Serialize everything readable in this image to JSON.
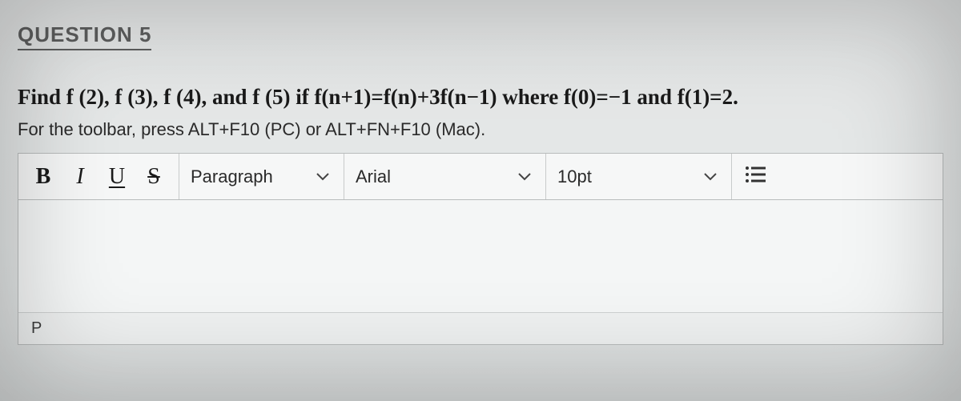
{
  "question": {
    "label": "QUESTION 5",
    "prompt": "Find f (2), f (3), f (4), and f (5) if f(n+1)=f(n)+3f(n−1) where f(0)=−1 and f(1)=2.",
    "hint": "For the toolbar, press ALT+F10 (PC) or ALT+FN+F10 (Mac)."
  },
  "toolbar": {
    "bold": "B",
    "italic": "I",
    "underline": "U",
    "strike": "S",
    "block_format": "Paragraph",
    "font_family": "Arial",
    "font_size": "10pt"
  },
  "status": {
    "path": "P"
  }
}
